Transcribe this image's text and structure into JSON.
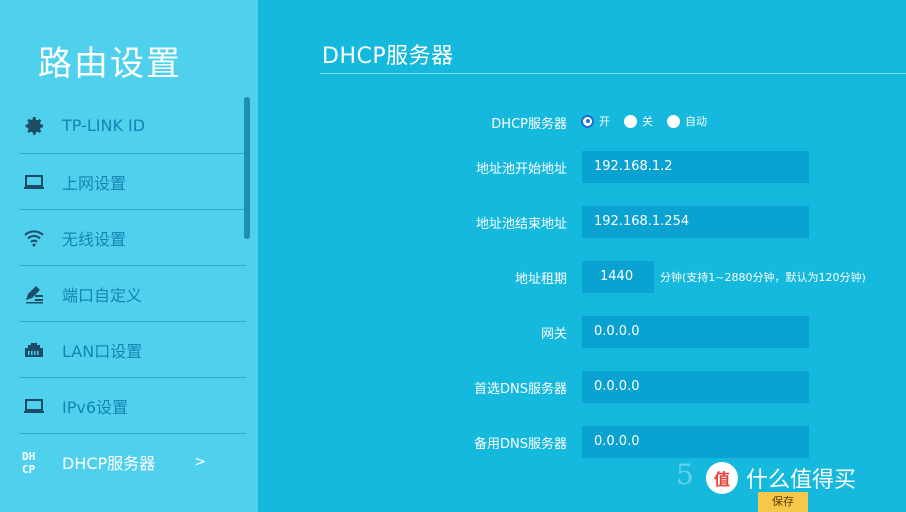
{
  "sidebar": {
    "title": "路由设置",
    "items": [
      {
        "label": "TP-LINK ID",
        "icon": "gear-icon"
      },
      {
        "label": "上网设置",
        "icon": "laptop-icon"
      },
      {
        "label": "无线设置",
        "icon": "wifi-icon"
      },
      {
        "label": "端口自定义",
        "icon": "pen-list-icon"
      },
      {
        "label": "LAN口设置",
        "icon": "lan-port-icon"
      },
      {
        "label": "IPv6设置",
        "icon": "laptop-icon"
      },
      {
        "label": "DHCP服务器",
        "icon": "dhcp-icon",
        "active": true,
        "arrow": ">"
      }
    ]
  },
  "main": {
    "title": "DHCP服务器",
    "dhcp_label": "DHCP服务器",
    "dhcp_options": [
      "开",
      "关",
      "自动"
    ],
    "dhcp_selected": "开",
    "pool_start_label": "地址池开始地址",
    "pool_start_value": "192.168.1.2",
    "pool_end_label": "地址池结束地址",
    "pool_end_value": "192.168.1.254",
    "lease_label": "地址租期",
    "lease_value": "1440",
    "lease_hint": "分钟(支持1~2880分钟，默认为120分钟)",
    "gateway_label": "网关",
    "gateway_value": "0.0.0.0",
    "dns1_label": "首选DNS服务器",
    "dns1_value": "0.0.0.0",
    "dns2_label": "备用DNS服务器",
    "dns2_value": "0.0.0.0",
    "save_label": "保存"
  },
  "watermark": {
    "logo_glyph": "值",
    "text": "什么值得买",
    "partial_number": "5"
  },
  "colors": {
    "sidebar_bg": "#4fd1ee",
    "main_bg": "#14b9dd",
    "field_bg": "#0aa3d1",
    "nav_text": "#1583b4",
    "radio_selected": "#1b6fd2"
  }
}
